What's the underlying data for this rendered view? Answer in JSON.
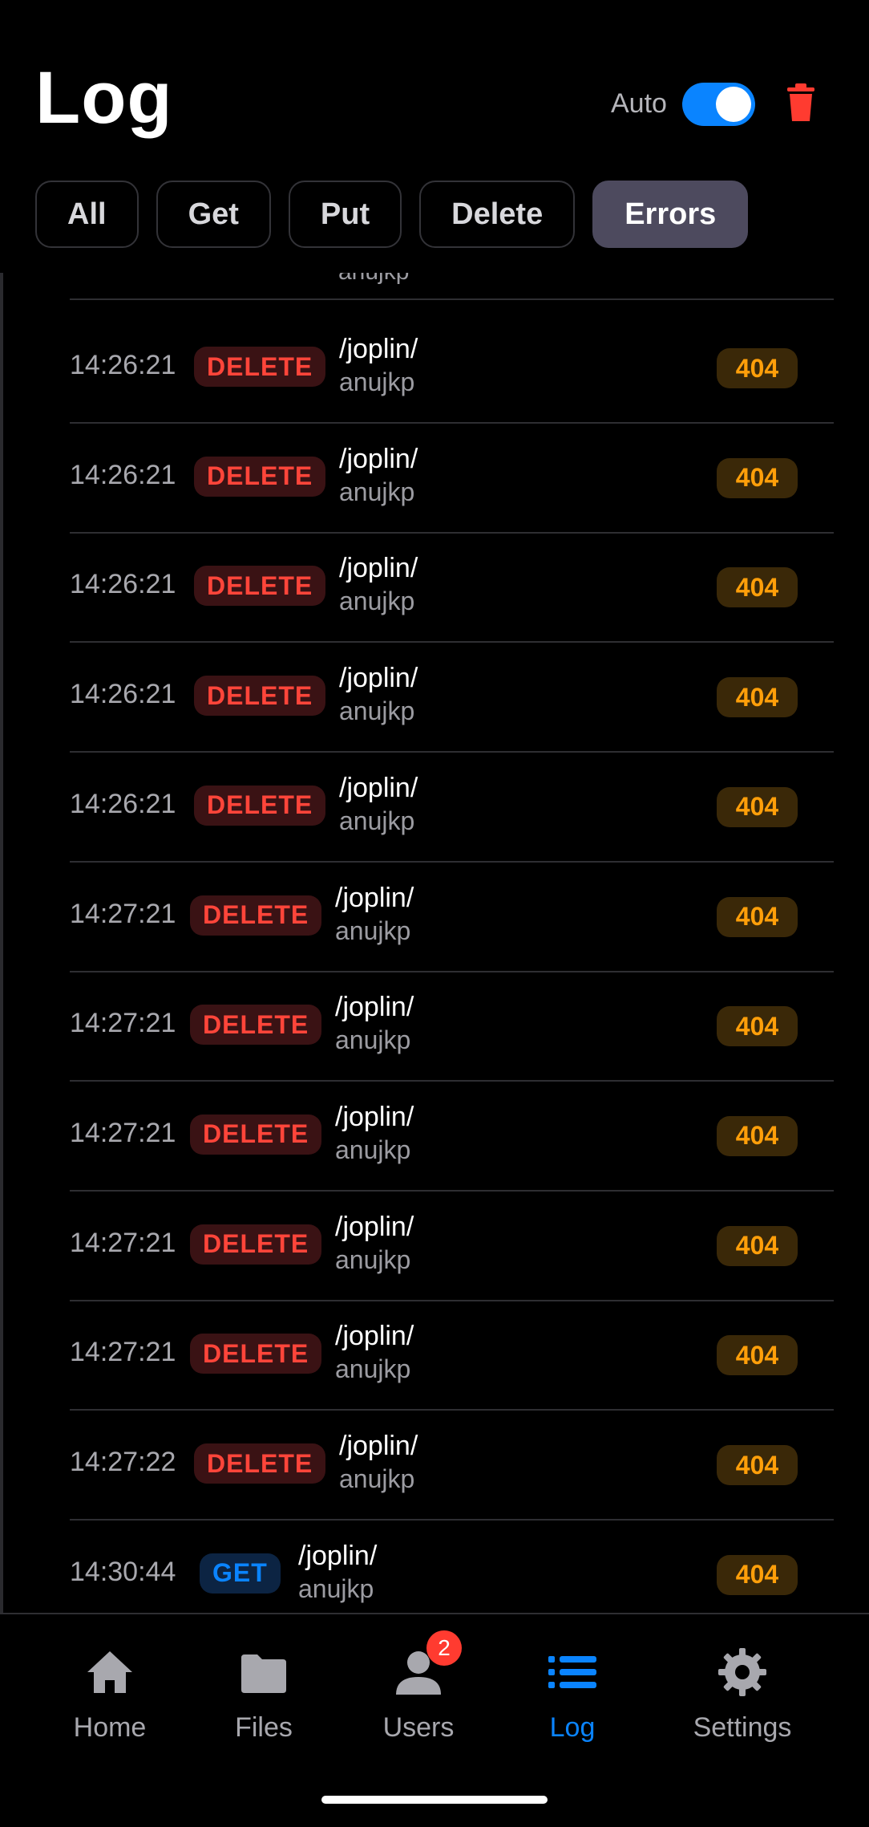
{
  "header": {
    "title": "Log",
    "auto_label": "Auto",
    "auto_enabled": true
  },
  "filters": [
    {
      "label": "All",
      "active": false
    },
    {
      "label": "Get",
      "active": false
    },
    {
      "label": "Put",
      "active": false
    },
    {
      "label": "Delete",
      "active": false
    },
    {
      "label": "Errors",
      "active": true
    }
  ],
  "partial_row": {
    "user": "anujkp"
  },
  "entries": [
    {
      "time": "14:26:21",
      "method": "DELETE",
      "path": "/joplin/",
      "user": "anujkp",
      "status": "404"
    },
    {
      "time": "14:26:21",
      "method": "DELETE",
      "path": "/joplin/",
      "user": "anujkp",
      "status": "404"
    },
    {
      "time": "14:26:21",
      "method": "DELETE",
      "path": "/joplin/",
      "user": "anujkp",
      "status": "404"
    },
    {
      "time": "14:26:21",
      "method": "DELETE",
      "path": "/joplin/",
      "user": "anujkp",
      "status": "404"
    },
    {
      "time": "14:26:21",
      "method": "DELETE",
      "path": "/joplin/",
      "user": "anujkp",
      "status": "404"
    },
    {
      "time": "14:27:21",
      "method": "DELETE",
      "path": "/joplin/",
      "user": "anujkp",
      "status": "404"
    },
    {
      "time": "14:27:21",
      "method": "DELETE",
      "path": "/joplin/",
      "user": "anujkp",
      "status": "404"
    },
    {
      "time": "14:27:21",
      "method": "DELETE",
      "path": "/joplin/",
      "user": "anujkp",
      "status": "404"
    },
    {
      "time": "14:27:21",
      "method": "DELETE",
      "path": "/joplin/",
      "user": "anujkp",
      "status": "404"
    },
    {
      "time": "14:27:21",
      "method": "DELETE",
      "path": "/joplin/",
      "user": "anujkp",
      "status": "404"
    },
    {
      "time": "14:27:22",
      "method": "DELETE",
      "path": "/joplin/",
      "user": "anujkp",
      "status": "404"
    },
    {
      "time": "14:30:44",
      "method": "GET",
      "path": "/joplin/",
      "user": "anujkp",
      "status": "404"
    }
  ],
  "tabs": [
    {
      "label": "Home",
      "icon": "house-icon",
      "active": false
    },
    {
      "label": "Files",
      "icon": "folder-icon",
      "active": false
    },
    {
      "label": "Users",
      "icon": "person-icon",
      "active": false,
      "badge": "2"
    },
    {
      "label": "Log",
      "icon": "list-icon",
      "active": true
    },
    {
      "label": "Settings",
      "icon": "gear-icon",
      "active": false
    }
  ],
  "colors": {
    "accent": "#0a84ff",
    "delete": "#ff453a",
    "status_404": "#ff9f0a",
    "chip_active": "#4d4a5e"
  }
}
